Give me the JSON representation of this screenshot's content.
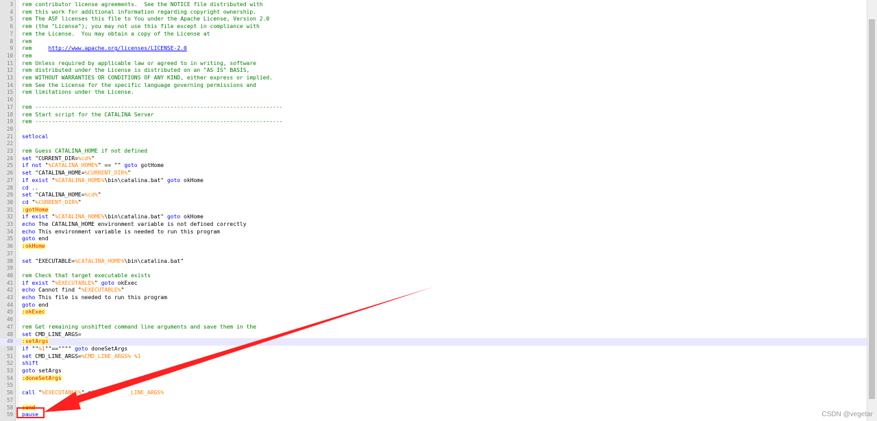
{
  "editor": {
    "first_line_number": 3,
    "current_line_number": 49,
    "lines": [
      {
        "n": "3",
        "parts": [
          {
            "t": "rem contributor license agreements.  See the NOTICE file distributed with",
            "c": "rem"
          }
        ]
      },
      {
        "n": "4",
        "parts": [
          {
            "t": "rem this work for additional information regarding copyright ownership.",
            "c": "rem"
          }
        ]
      },
      {
        "n": "5",
        "parts": [
          {
            "t": "rem The ASF licenses this file to You under the Apache License, Version 2.0",
            "c": "rem"
          }
        ]
      },
      {
        "n": "6",
        "parts": [
          {
            "t": "rem (the \"License\"); you may not use this file except in compliance with",
            "c": "rem"
          }
        ]
      },
      {
        "n": "7",
        "parts": [
          {
            "t": "rem the License.  You may obtain a copy of the License at",
            "c": "rem"
          }
        ]
      },
      {
        "n": "8",
        "parts": [
          {
            "t": "rem",
            "c": "rem"
          }
        ]
      },
      {
        "n": "9",
        "parts": [
          {
            "t": "rem     ",
            "c": "rem"
          },
          {
            "t": "http://www.apache.org/licenses/LICENSE-2.0",
            "c": "url"
          }
        ]
      },
      {
        "n": "10",
        "parts": [
          {
            "t": "rem",
            "c": "rem"
          }
        ]
      },
      {
        "n": "11",
        "parts": [
          {
            "t": "rem Unless required by applicable law or agreed to in writing, software",
            "c": "rem"
          }
        ]
      },
      {
        "n": "12",
        "parts": [
          {
            "t": "rem distributed under the License is distributed on an \"AS IS\" BASIS,",
            "c": "rem"
          }
        ]
      },
      {
        "n": "13",
        "parts": [
          {
            "t": "rem WITHOUT WARRANTIES OR CONDITIONS OF ANY KIND, either express or implied.",
            "c": "rem"
          }
        ]
      },
      {
        "n": "14",
        "parts": [
          {
            "t": "rem See the License for the specific language governing permissions and",
            "c": "rem"
          }
        ]
      },
      {
        "n": "15",
        "parts": [
          {
            "t": "rem limitations under the License.",
            "c": "rem"
          }
        ]
      },
      {
        "n": "16",
        "parts": []
      },
      {
        "n": "17",
        "parts": [
          {
            "t": "rem ---------------------------------------------------------------------------",
            "c": "rem"
          }
        ]
      },
      {
        "n": "18",
        "parts": [
          {
            "t": "rem Start script for the CATALINA Server",
            "c": "rem"
          }
        ]
      },
      {
        "n": "19",
        "parts": [
          {
            "t": "rem ---------------------------------------------------------------------------",
            "c": "rem"
          }
        ]
      },
      {
        "n": "20",
        "parts": []
      },
      {
        "n": "21",
        "parts": [
          {
            "t": "setlocal",
            "c": "kw"
          }
        ]
      },
      {
        "n": "22",
        "parts": []
      },
      {
        "n": "23",
        "parts": [
          {
            "t": "rem Guess CATALINA_HOME if not defined",
            "c": "rem"
          }
        ]
      },
      {
        "n": "24",
        "parts": [
          {
            "t": "set",
            "c": "kw"
          },
          {
            "t": " \"CURRENT_DIR=",
            "c": "str"
          },
          {
            "t": "%cd%",
            "c": "var"
          },
          {
            "t": "\"",
            "c": "str"
          }
        ]
      },
      {
        "n": "25",
        "parts": [
          {
            "t": "if not",
            "c": "kw"
          },
          {
            "t": " \"",
            "c": "str"
          },
          {
            "t": "%CATALINA_HOME%",
            "c": "var"
          },
          {
            "t": "\" == \"\" ",
            "c": "str"
          },
          {
            "t": "goto",
            "c": "kw"
          },
          {
            "t": " gotHome",
            "c": "str"
          }
        ]
      },
      {
        "n": "26",
        "parts": [
          {
            "t": "set",
            "c": "kw"
          },
          {
            "t": " \"CATALINA_HOME=",
            "c": "str"
          },
          {
            "t": "%CURRENT_DIR%",
            "c": "var"
          },
          {
            "t": "\"",
            "c": "str"
          }
        ]
      },
      {
        "n": "27",
        "parts": [
          {
            "t": "if exist",
            "c": "kw"
          },
          {
            "t": " \"",
            "c": "str"
          },
          {
            "t": "%CATALINA_HOME%",
            "c": "var"
          },
          {
            "t": "\\bin\\catalina.bat\" ",
            "c": "str"
          },
          {
            "t": "goto",
            "c": "kw"
          },
          {
            "t": " okHome",
            "c": "str"
          }
        ]
      },
      {
        "n": "28",
        "parts": [
          {
            "t": "cd",
            "c": "kw"
          },
          {
            "t": " ..",
            "c": "str"
          }
        ]
      },
      {
        "n": "29",
        "parts": [
          {
            "t": "set",
            "c": "kw"
          },
          {
            "t": " \"CATALINA_HOME=",
            "c": "str"
          },
          {
            "t": "%cd%",
            "c": "var"
          },
          {
            "t": "\"",
            "c": "str"
          }
        ]
      },
      {
        "n": "30",
        "parts": [
          {
            "t": "cd",
            "c": "kw"
          },
          {
            "t": " \"",
            "c": "str"
          },
          {
            "t": "%CURRENT_DIR%",
            "c": "var"
          },
          {
            "t": "\"",
            "c": "str"
          }
        ]
      },
      {
        "n": "31",
        "parts": [
          {
            "t": ":gotHome",
            "c": "label"
          }
        ]
      },
      {
        "n": "32",
        "parts": [
          {
            "t": "if exist",
            "c": "kw"
          },
          {
            "t": " \"",
            "c": "str"
          },
          {
            "t": "%CATALINA_HOME%",
            "c": "var"
          },
          {
            "t": "\\bin\\catalina.bat\" ",
            "c": "str"
          },
          {
            "t": "goto",
            "c": "kw"
          },
          {
            "t": " okHome",
            "c": "str"
          }
        ]
      },
      {
        "n": "33",
        "parts": [
          {
            "t": "echo",
            "c": "kw"
          },
          {
            "t": " The CATALINA_HOME environment variable is not defined correctly",
            "c": "str"
          }
        ]
      },
      {
        "n": "34",
        "parts": [
          {
            "t": "echo",
            "c": "kw"
          },
          {
            "t": " This environment variable is needed to run this program",
            "c": "str"
          }
        ]
      },
      {
        "n": "35",
        "parts": [
          {
            "t": "goto",
            "c": "kw"
          },
          {
            "t": " end",
            "c": "str"
          }
        ]
      },
      {
        "n": "36",
        "parts": [
          {
            "t": ":okHome",
            "c": "label"
          }
        ]
      },
      {
        "n": "37",
        "parts": []
      },
      {
        "n": "38",
        "parts": [
          {
            "t": "set",
            "c": "kw"
          },
          {
            "t": " \"EXECUTABLE=",
            "c": "str"
          },
          {
            "t": "%CATALINA_HOME%",
            "c": "var"
          },
          {
            "t": "\\bin\\catalina.bat\"",
            "c": "str"
          }
        ]
      },
      {
        "n": "39",
        "parts": []
      },
      {
        "n": "40",
        "parts": [
          {
            "t": "rem Check that target executable exists",
            "c": "rem"
          }
        ]
      },
      {
        "n": "41",
        "parts": [
          {
            "t": "if exist",
            "c": "kw"
          },
          {
            "t": " \"",
            "c": "str"
          },
          {
            "t": "%EXECUTABLE%",
            "c": "var"
          },
          {
            "t": "\" ",
            "c": "str"
          },
          {
            "t": "goto",
            "c": "kw"
          },
          {
            "t": " okExec",
            "c": "str"
          }
        ]
      },
      {
        "n": "42",
        "parts": [
          {
            "t": "echo",
            "c": "kw"
          },
          {
            "t": " Cannot find \"",
            "c": "str"
          },
          {
            "t": "%EXECUTABLE%",
            "c": "var"
          },
          {
            "t": "\"",
            "c": "str"
          }
        ]
      },
      {
        "n": "43",
        "parts": [
          {
            "t": "echo",
            "c": "kw"
          },
          {
            "t": " This file is needed to run this program",
            "c": "str"
          }
        ]
      },
      {
        "n": "44",
        "parts": [
          {
            "t": "goto",
            "c": "kw"
          },
          {
            "t": " end",
            "c": "str"
          }
        ]
      },
      {
        "n": "45",
        "parts": [
          {
            "t": ":okExec",
            "c": "label"
          }
        ]
      },
      {
        "n": "46",
        "parts": []
      },
      {
        "n": "47",
        "parts": [
          {
            "t": "rem Get remaining unshifted command line arguments and save them in the",
            "c": "rem"
          }
        ]
      },
      {
        "n": "48",
        "parts": [
          {
            "t": "set",
            "c": "kw"
          },
          {
            "t": " CMD_LINE_ARGS=",
            "c": "str"
          }
        ]
      },
      {
        "n": "49",
        "parts": [
          {
            "t": ":setArgs",
            "c": "label"
          }
        ]
      },
      {
        "n": "50",
        "parts": [
          {
            "t": "if",
            "c": "kw"
          },
          {
            "t": " \"\"",
            "c": "str"
          },
          {
            "t": "%1",
            "c": "var"
          },
          {
            "t": "\"\"==\"\"\"\" ",
            "c": "str"
          },
          {
            "t": "goto",
            "c": "kw"
          },
          {
            "t": " doneSetArgs",
            "c": "str"
          }
        ]
      },
      {
        "n": "51",
        "parts": [
          {
            "t": "set",
            "c": "kw"
          },
          {
            "t": " CMD_LINE_ARGS=",
            "c": "str"
          },
          {
            "t": "%CMD_LINE_ARGS% %1",
            "c": "var"
          }
        ]
      },
      {
        "n": "52",
        "parts": [
          {
            "t": "shift",
            "c": "kw"
          }
        ]
      },
      {
        "n": "53",
        "parts": [
          {
            "t": "goto",
            "c": "kw"
          },
          {
            "t": " setArgs",
            "c": "str"
          }
        ]
      },
      {
        "n": "54",
        "parts": [
          {
            "t": ":doneSetArgs",
            "c": "label"
          }
        ]
      },
      {
        "n": "55",
        "parts": []
      },
      {
        "n": "56",
        "parts": [
          {
            "t": "call",
            "c": "kw"
          },
          {
            "t": " \"",
            "c": "str"
          },
          {
            "t": "%EXECUTABLE%",
            "c": "var"
          },
          {
            "t": "\" sta",
            "c": "str"
          },
          {
            "t": "         ",
            "c": "str"
          },
          {
            "t": "_LINE_ARGS%",
            "c": "var"
          }
        ]
      },
      {
        "n": "57",
        "parts": []
      },
      {
        "n": "58",
        "parts": [
          {
            "t": ":end",
            "c": "label"
          }
        ]
      },
      {
        "n": "59",
        "parts": [
          {
            "t": "pause",
            "c": "kw"
          }
        ]
      }
    ]
  },
  "annotation": {
    "arrow_color": "#ff2020",
    "box_color": "#ff2020"
  },
  "watermark": "CSDN @vegetar"
}
